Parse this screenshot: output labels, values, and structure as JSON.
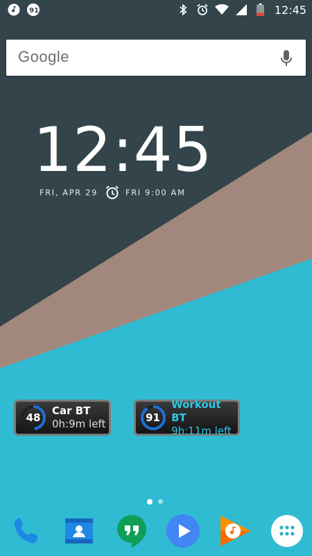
{
  "status_bar": {
    "time": "12:45",
    "notification_icons": [
      "music-note-icon",
      "badge-91-icon"
    ],
    "notification_badge": "91",
    "system_icons": [
      "bluetooth-icon",
      "alarm-icon",
      "wifi-icon",
      "signal-icon",
      "battery-icon"
    ]
  },
  "search": {
    "logo_text": "Google",
    "voice_icon": "microphone-icon"
  },
  "clock": {
    "time": "12:45",
    "date": "FRI, APR 29",
    "alarm": "FRI 9:00 AM",
    "alarm_icon": "alarm-clock-icon"
  },
  "widgets": [
    {
      "name": "Car BT",
      "level": "48",
      "level_fraction": 0.48,
      "time_left": "0h:9m left",
      "accent": "#1e6fd8"
    },
    {
      "name": "Workout BT",
      "level": "91",
      "level_fraction": 0.91,
      "time_left": "9h:11m left",
      "accent": "#1e6fd8"
    }
  ],
  "page_indicator": {
    "pages": 2,
    "active": 0
  },
  "dock": {
    "apps": [
      "phone-icon",
      "contacts-icon",
      "hangouts-icon",
      "play-store-icon",
      "play-music-icon",
      "app-drawer-icon"
    ]
  },
  "colors": {
    "wallpaper_dark": "#33454b",
    "wallpaper_taupe": "#a2877d",
    "wallpaper_cyan": "#2fbcd3",
    "widget_accent": "#1e6fd8",
    "widget_name_highlight": "#2ec8e6"
  }
}
